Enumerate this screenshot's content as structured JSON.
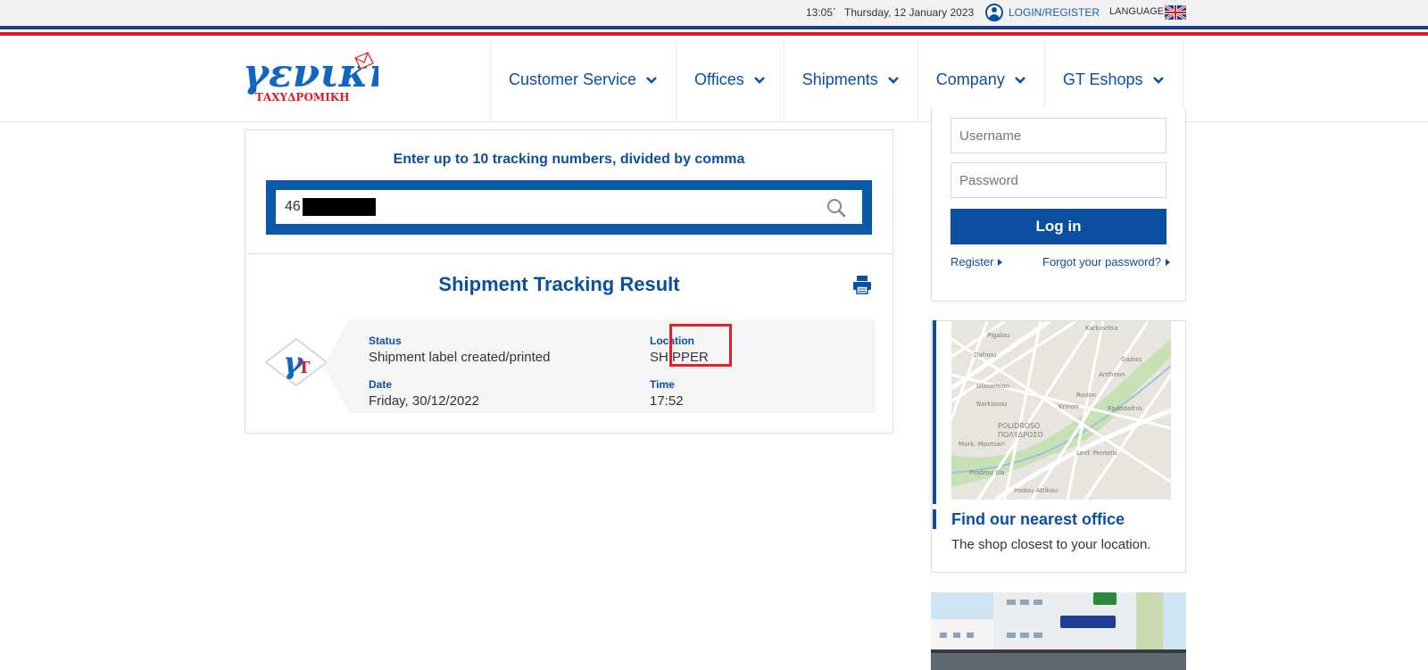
{
  "topbar": {
    "clock": "13:05΄",
    "date": "Thursday, 12 January 2023",
    "login_label": "LOGIN/REGISTER",
    "language_label": "LANGUAGE:"
  },
  "logo": {
    "text_main": "γενική",
    "text_sub": "ΤΑΧΥΔΡΟΜΙΚΗ"
  },
  "nav": {
    "items": [
      {
        "label": "Customer Service"
      },
      {
        "label": "Offices"
      },
      {
        "label": "Shipments"
      },
      {
        "label": "Company"
      },
      {
        "label": "GT Eshops"
      }
    ]
  },
  "tracking": {
    "prompt": "Enter up to 10 tracking numbers, divided by comma",
    "input_value": "46",
    "result_title": "Shipment Tracking Result",
    "status_label": "Status",
    "status_value": "Shipment label created/printed",
    "location_label": "Location",
    "location_value": "SHIPPER",
    "date_label": "Date",
    "date_value": "Friday, 30/12/2022",
    "time_label": "Time",
    "time_value": "17:52"
  },
  "login": {
    "username_placeholder": "Username",
    "password_placeholder": "Password",
    "button_label": "Log in",
    "register_label": "Register",
    "forgot_label": "Forgot your password?"
  },
  "office": {
    "title": "Find our nearest office",
    "subtitle": "The shop closest to your location.",
    "map_labels": [
      "Pigalou",
      "Karkavitsa",
      "Dafnou",
      "Gazias",
      "Anthéon",
      "Glasemion",
      "Narkissou",
      "Rodon",
      "Krinon",
      "Rododafnis",
      "POLIDROSO",
      "ΠΟΛΥΔΡΟΣΟ",
      "Leof. Pentelis",
      "Mark. Mpotsari",
      "Irodou Attikou",
      "Prodrou Ilia"
    ]
  },
  "colors": {
    "brand_blue": "#0b4fa3",
    "stripe_blue": "#1c3f96",
    "stripe_red": "#e11b22",
    "highlight_red": "#e3202a"
  }
}
